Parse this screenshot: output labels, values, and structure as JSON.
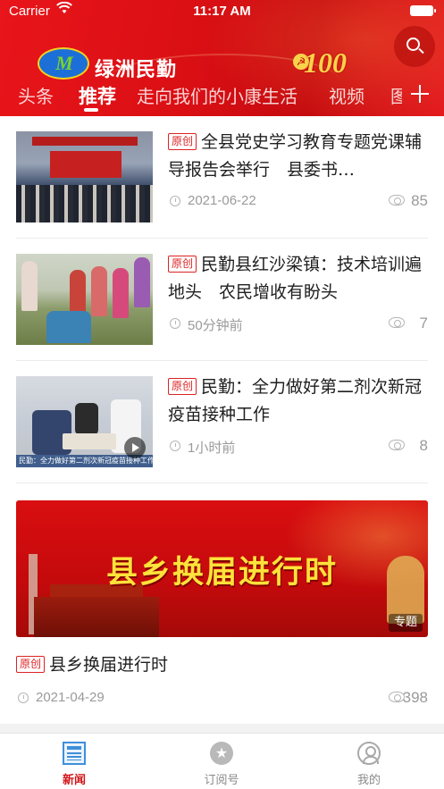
{
  "status_bar": {
    "carrier": "Carrier",
    "time": "11:17 AM"
  },
  "header": {
    "app_title": "绿洲民勤",
    "anniversary_badge": "100",
    "logo_letter": "M",
    "search_icon": "search-icon",
    "tabs": [
      {
        "label": "头条",
        "active": false
      },
      {
        "label": "推荐",
        "active": true
      },
      {
        "label": "走向我们的小康生活",
        "active": false
      },
      {
        "label": "视频",
        "active": false
      },
      {
        "label": "图",
        "active": false
      }
    ],
    "add_tab_icon": "plus-icon"
  },
  "feed": {
    "original_tag": "原创",
    "items": [
      {
        "title": "全县党史学习教育专题党课辅导报告会举行　县委书…",
        "time": "2021-06-22",
        "views": "85"
      },
      {
        "title": "民勤县红沙梁镇：技术培训遍地头　农民增收有盼头",
        "time": "50分钟前",
        "views": "7"
      },
      {
        "title": "民勤：全力做好第二剂次新冠疫苗接种工作",
        "time": "1小时前",
        "views": "8",
        "has_video": true,
        "thumb_caption": "民勤：全力做好第二剂次新冠疫苗接种工作"
      }
    ],
    "special": {
      "banner_heading": "县乡换届进行时",
      "banner_topic_badge": "专题",
      "title": "县乡换届进行时",
      "time": "2021-04-29",
      "views": "398"
    }
  },
  "tabbar": {
    "items": [
      {
        "label": "新闻",
        "icon": "news-icon",
        "active": true
      },
      {
        "label": "订阅号",
        "icon": "subscription-icon",
        "active": false
      },
      {
        "label": "我的",
        "icon": "profile-icon",
        "active": false
      }
    ]
  },
  "colors": {
    "brand_red": "#d90f14",
    "accent_yellow": "#ffe23a",
    "active_tab_red": "#d0161b",
    "meta_gray": "#9a9a9a"
  }
}
